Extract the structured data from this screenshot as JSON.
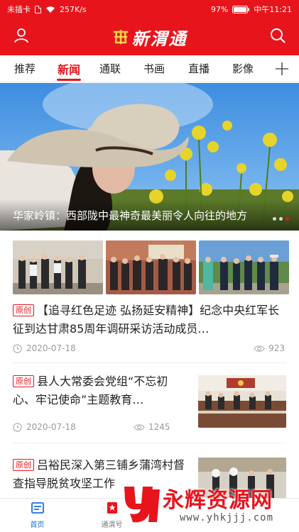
{
  "status_bar": {
    "carrier": "未插卡",
    "speed": "257K/s",
    "battery": "97%",
    "time": "中午11:21"
  },
  "header": {
    "logo_text": "新渭通",
    "icons": {
      "left": "user-icon",
      "right": "search-icon"
    }
  },
  "tabs": [
    {
      "label": "推荐",
      "active": false
    },
    {
      "label": "新闻",
      "active": true
    },
    {
      "label": "通联",
      "active": false
    },
    {
      "label": "书画",
      "active": false
    },
    {
      "label": "直播",
      "active": false
    },
    {
      "label": "影像",
      "active": false
    }
  ],
  "hero": {
    "caption": "华家岭镇：西部陇中最神奇最美丽令人向往的地方",
    "dots_total": 3,
    "active_dot": 2
  },
  "feed": [
    {
      "layout": "three-images",
      "tag": "原创",
      "title": "【追寻红色足迹 弘扬延安精神】纪念中央红军长征到达甘肃85周年调研采访活动成员…",
      "date": "2020-07-18",
      "views": "923"
    },
    {
      "layout": "right-image",
      "tag": "原创",
      "title": "县人大常委会党组“不忘初心、牢记使命”主题教育…",
      "date": "2020-07-18",
      "views": "1245"
    },
    {
      "layout": "right-image",
      "tag": "原创",
      "title": "吕裕民深入第三铺乡蒲湾村督查指导脱贫攻坚工作",
      "date": "",
      "views": ""
    }
  ],
  "bottom_nav": [
    {
      "label": "首页",
      "icon": "home-icon",
      "active": true
    },
    {
      "label": "通渭号",
      "icon": "bookmark-icon",
      "active": false
    },
    {
      "label": "",
      "icon": "",
      "active": false
    },
    {
      "label": "",
      "icon": "",
      "active": false
    }
  ],
  "watermark": {
    "text": "永辉资源网",
    "url": "www.yhkjjj.com"
  },
  "colors": {
    "brand_red": "#e8141b",
    "nav_active_blue": "#1e6fd6",
    "meta_gray": "#999999"
  }
}
